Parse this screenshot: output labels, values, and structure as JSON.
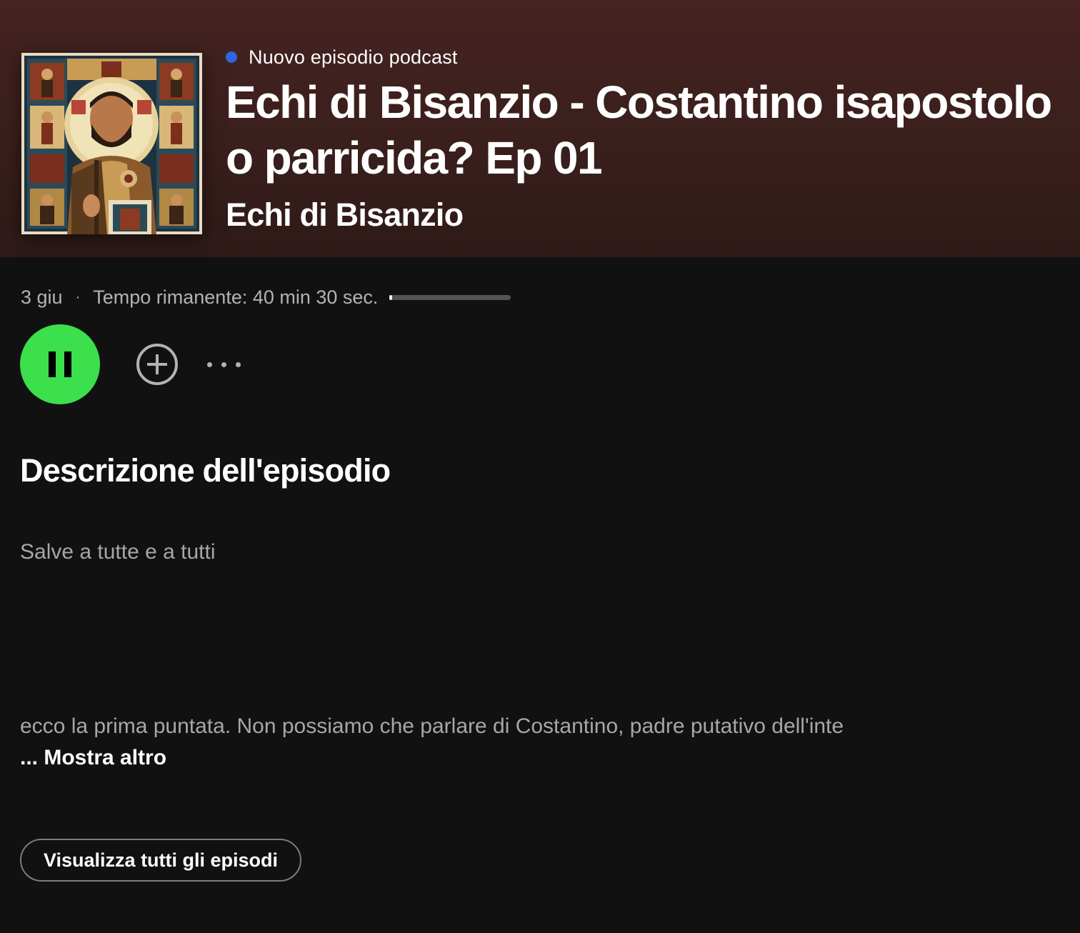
{
  "header": {
    "tag_label": "Nuovo episodio podcast",
    "episode_title": "Echi di Bisanzio - Costantino isapostolo o parricida? Ep 01",
    "show_name": "Echi di Bisanzio",
    "cover_icon": "byzantine-icon-artwork",
    "colors": {
      "gradient_top": "#452321",
      "dot": "#2d66e3"
    }
  },
  "meta": {
    "date": "3 giu",
    "separator": "·",
    "time_remaining": "Tempo rimanente: 40 min 30 sec.",
    "progress_fraction": 0.02
  },
  "controls": {
    "play_icon": "pause-icon",
    "add_icon": "add-circle-icon",
    "more_icon": "more-options-icon",
    "accent_color": "#3be04c"
  },
  "description": {
    "title": "Descrizione dell'episodio",
    "line1": "Salve a tutte e a tutti",
    "line2": "ecco la prima puntata. Non possiamo che parlare di Costantino, padre putativo dell'inte",
    "show_more": "... Mostra altro"
  },
  "actions": {
    "all_episodes": "Visualizza tutti gli episodi"
  }
}
